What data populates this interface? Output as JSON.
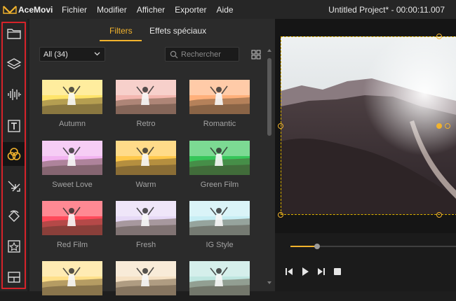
{
  "app": {
    "logo_text": "AceMovi",
    "menu": [
      "Fichier",
      "Modifier",
      "Afficher",
      "Exporter",
      "Aide"
    ],
    "project_title": "Untitled Project* - 00:00:11.007"
  },
  "toolbar": {
    "tools": [
      {
        "icon": "folder-icon"
      },
      {
        "icon": "layers-icon"
      },
      {
        "icon": "audio-waveform-icon"
      },
      {
        "icon": "text-icon"
      },
      {
        "icon": "filters-icon",
        "active": true
      },
      {
        "icon": "transitions-icon"
      },
      {
        "icon": "animation-icon"
      },
      {
        "icon": "elements-icon"
      },
      {
        "icon": "split-screen-icon"
      }
    ],
    "highlight_color": "#d6232a"
  },
  "panel": {
    "tabs": [
      {
        "label": "Filters",
        "active": true
      },
      {
        "label": "Effets spéciaux",
        "active": false
      }
    ],
    "dropdown_value": "All (34)",
    "search_placeholder": "Rechercher",
    "filters": [
      {
        "name": "Autumn",
        "tint": "#ffe46a"
      },
      {
        "name": "Retro",
        "tint": "#f3b7b0"
      },
      {
        "name": "Romantic",
        "tint": "#ffb07a"
      },
      {
        "name": "Sweet Love",
        "tint": "#f2b3f0"
      },
      {
        "name": "Warm",
        "tint": "#ffc84a"
      },
      {
        "name": "Green Film",
        "tint": "#36c65a"
      },
      {
        "name": "Red Film",
        "tint": "#ff4a5a"
      },
      {
        "name": "Fresh",
        "tint": "#e6d9f6"
      },
      {
        "name": "IG Style",
        "tint": "#c7eef4"
      },
      {
        "name": "",
        "tint": "#ffe08a"
      },
      {
        "name": "",
        "tint": "#f5e1c4"
      },
      {
        "name": "",
        "tint": "#bfe6e0"
      }
    ]
  },
  "player": {
    "progress": 0.16,
    "accent": "#f2b32d"
  }
}
